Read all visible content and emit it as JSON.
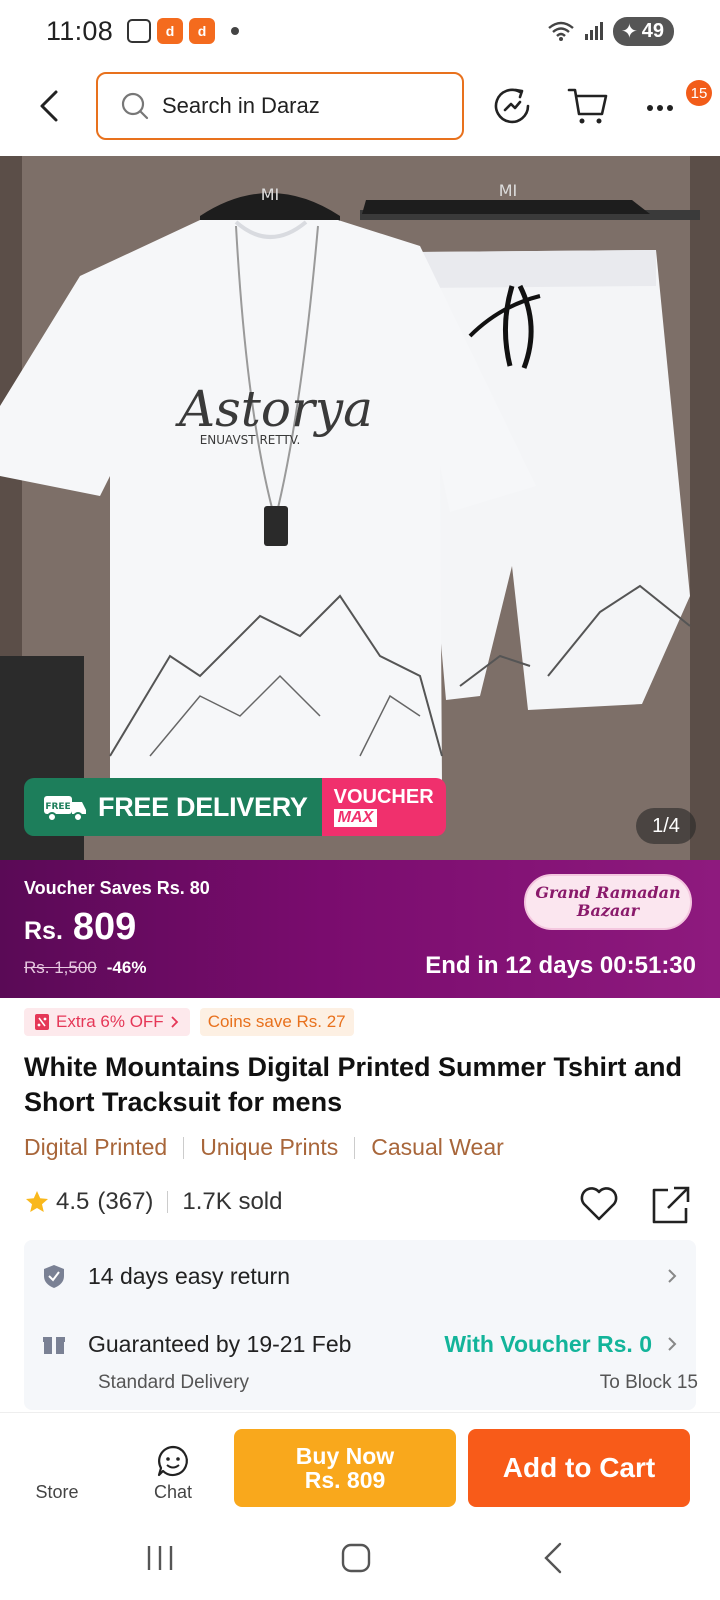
{
  "status_bar": {
    "time": "11:08",
    "battery": "49"
  },
  "topbar": {
    "search_placeholder": "Search in Daraz",
    "cart_badge": "15"
  },
  "hero": {
    "image_description_icon": "product-photo",
    "free_delivery_small": "FREE",
    "free_delivery": "FREE DELIVERY",
    "voucher_top": "VOUCHER",
    "voucher_bottom": "MAX",
    "page_indicator": "1/4",
    "shirt_print_title": "Astorya",
    "shirt_print_sub": "ENUAVST RETTV.",
    "hanger_brand": "MI"
  },
  "price": {
    "voucher_saves": "Voucher Saves Rs. 80",
    "currency": "Rs.",
    "amount": "809",
    "old_price": "Rs. 1,500",
    "discount": "-46%",
    "campaign_line1": "Grand Ramadan",
    "campaign_line2": "Bazaar",
    "countdown": "End in 12 days 00:51:30"
  },
  "chips": {
    "extra_off": "Extra 6% OFF",
    "coins": "Coins save Rs. 27"
  },
  "product": {
    "title": "White Mountains Digital Printed Summer Tshirt and Short Tracksuit for mens",
    "tags": [
      "Digital Printed",
      "Unique Prints",
      "Casual Wear"
    ],
    "rating": "4.5",
    "reviews": "(367)",
    "sold": "1.7K sold"
  },
  "info": {
    "return_text": "14 days easy return",
    "delivery_text": "Guaranteed by 19-21 Feb",
    "voucher_text": "With Voucher Rs. 0",
    "delivery_type": "Standard Delivery",
    "destination": "To Block 15"
  },
  "actions": {
    "store": "Store",
    "chat": "Chat",
    "buy_now_line1": "Buy Now",
    "buy_now_line2": "Rs. 809",
    "add_to_cart": "Add to Cart"
  },
  "colors": {
    "accent_orange": "#f85b19",
    "buy_yellow": "#f9a81c",
    "price_purple": "#7a0c6e",
    "voucher_green": "#13b49a",
    "delivery_green": "#1d7e5b",
    "voucher_pink": "#f0306d"
  }
}
